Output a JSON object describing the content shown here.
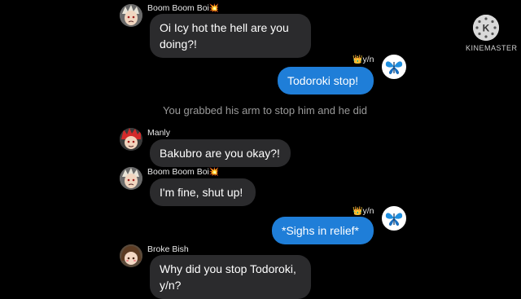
{
  "watermark": {
    "text": "KINEMASTER"
  },
  "colors": {
    "bubble_dark": "#2b2b2d",
    "bubble_blue": "#1f7ed8",
    "background": "#000000"
  },
  "messages": [
    {
      "sender": "Boom Boom Boi",
      "sender_emoji": "💥",
      "avatar": "bakugo-avatar",
      "text_lines": [
        "Oi Icy hot the hell are you",
        "doing?!"
      ]
    },
    {
      "sender": "y/n",
      "sender_emoji": "👑",
      "avatar": "butterfly-avatar",
      "text": "Todoroki stop!"
    },
    {
      "narration": "You grabbed his arm to stop him and he did"
    },
    {
      "sender": "Manly",
      "avatar": "kirishima-avatar",
      "text": "Bakubro are you okay?!"
    },
    {
      "sender": "Boom Boom Boi",
      "sender_emoji": "💥",
      "avatar": "bakugo-avatar",
      "text": "I'm fine, shut up!"
    },
    {
      "sender": "y/n",
      "sender_emoji": "👑",
      "avatar": "butterfly-avatar",
      "text": "*Sighs in relief*"
    },
    {
      "sender": "Broke Bish",
      "avatar": "uraraka-avatar",
      "text_lines": [
        "Why did you stop Todoroki,",
        "y/n?"
      ]
    }
  ]
}
